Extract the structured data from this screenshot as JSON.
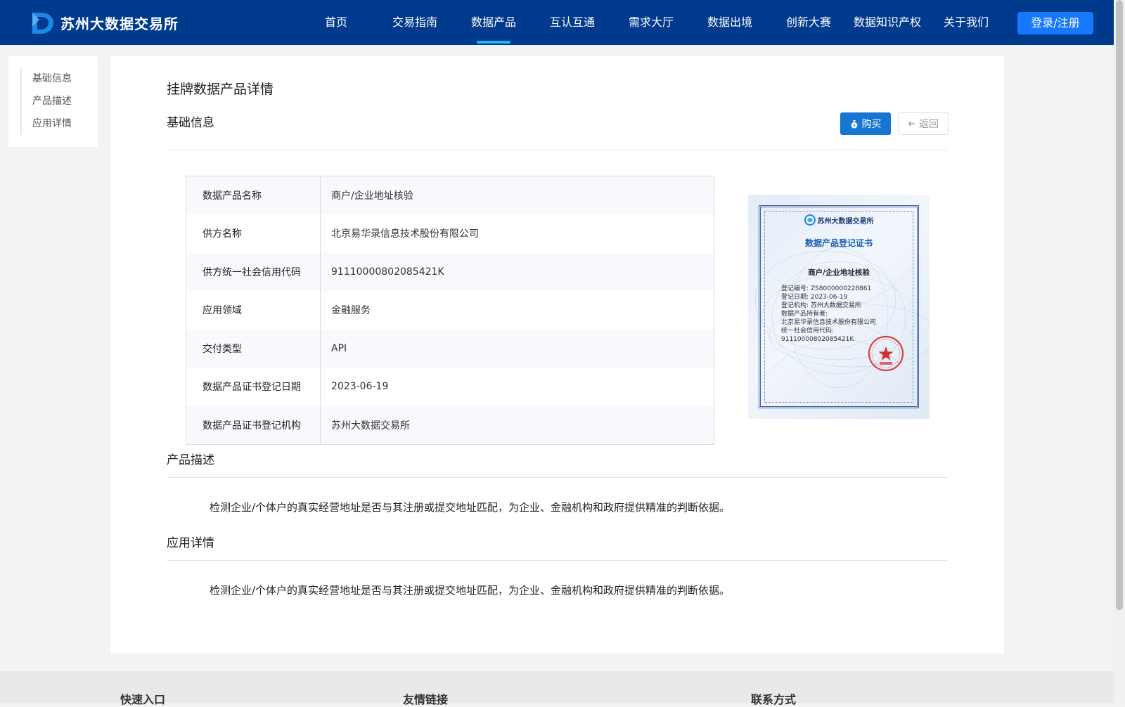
{
  "header": {
    "logo_text": "苏州大数据交易所",
    "nav": [
      {
        "label": "首页",
        "active": false
      },
      {
        "label": "交易指南",
        "active": false
      },
      {
        "label": "数据产品",
        "active": true
      },
      {
        "label": "互认互通",
        "active": false
      },
      {
        "label": "需求大厅",
        "active": false
      },
      {
        "label": "数据出境",
        "active": false
      },
      {
        "label": "创新大赛",
        "active": false
      },
      {
        "label": "数据知识产权",
        "active": false
      },
      {
        "label": "关于我们",
        "active": false
      }
    ],
    "login_label": "登录/注册"
  },
  "side_nav": {
    "items": [
      "基础信息",
      "产品描述",
      "应用详情"
    ]
  },
  "main": {
    "page_title": "挂牌数据产品详情",
    "basic_section_title": "基础信息",
    "buy_label": "购买",
    "back_label": "返回",
    "info_rows": [
      {
        "label": "数据产品名称",
        "value": "商户/企业地址核验"
      },
      {
        "label": "供方名称",
        "value": "北京易华录信息技术股份有限公司"
      },
      {
        "label": "供方统一社会信用代码",
        "value": "91110000802085421K"
      },
      {
        "label": "应用领域",
        "value": "金融服务"
      },
      {
        "label": "交付类型",
        "value": "API"
      },
      {
        "label": "数据产品证书登记日期",
        "value": "2023-06-19"
      },
      {
        "label": "数据产品证书登记机构",
        "value": "苏州大数据交易所"
      }
    ],
    "certificate": {
      "org_name": "苏州大数据交易所",
      "title": "数据产品登记证书",
      "product_name": "商户/企业地址核验",
      "lines": [
        "登记编号: ZS8000000228861",
        "登记日期: 2023-06-19",
        "登记机构: 苏州大数据交易所",
        "数据产品持有者:",
        "北京易华录信息技术股份有限公司",
        "统一社会信用代码:",
        "91110000802085421K"
      ]
    },
    "desc_section_title": "产品描述",
    "desc_text": "检测企业/个体户的真实经营地址是否与其注册或提交地址匹配，为企业、金融机构和政府提供精准的判断依据。",
    "app_section_title": "应用详情",
    "app_text": "检测企业/个体户的真实经营地址是否与其注册或提交地址匹配，为企业、金融机构和政府提供精准的判断依据。"
  },
  "footer": {
    "quick_entry": "快速入口",
    "friend_links": "友情链接",
    "contact": "联系方式"
  },
  "colors": {
    "header_bg": "#003a8c",
    "nav_active_underline": "#2bb0f0",
    "login_button": "#1677ff",
    "buy_button": "#1676d2"
  }
}
